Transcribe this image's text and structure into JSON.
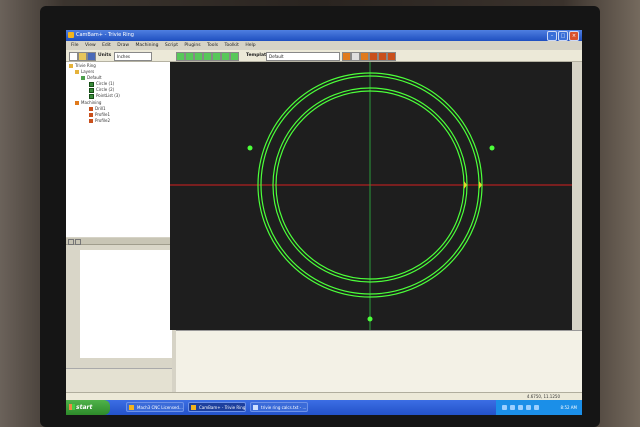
{
  "window": {
    "title": "CamBam+ - Trivie Ring"
  },
  "menu": [
    "File",
    "View",
    "Edit",
    "Draw",
    "Machining",
    "Script",
    "Plugins",
    "Tools",
    "Toolkit",
    "Help"
  ],
  "toolbar": {
    "units_label": "Units",
    "units_value": "Inches",
    "template_label": "Template",
    "template_value": "Default"
  },
  "tree": {
    "root": "Trivie Ring",
    "layers": "Layers",
    "default_layer": "Default",
    "shapes": [
      "Circle (1)",
      "Circle (2)",
      "PointList (3)"
    ],
    "machining": "Machining",
    "parts": [
      "Drill1",
      "Profile1",
      "Profile2"
    ]
  },
  "status": {
    "coords": "4.6750, 11.1250"
  },
  "taskbar": {
    "start": "start",
    "tasks": [
      "Mach3 CNC Licensed...",
      "CamBam+ - Trivie Ring",
      "trivie ring calcs.txt - ..."
    ],
    "clock": "8:52 AM"
  },
  "colors": {
    "shape": "#4cff3a",
    "x_axis": "#d42020",
    "y_axis": "#2a9a3a",
    "canvas_bg": "#1e1e1e"
  }
}
